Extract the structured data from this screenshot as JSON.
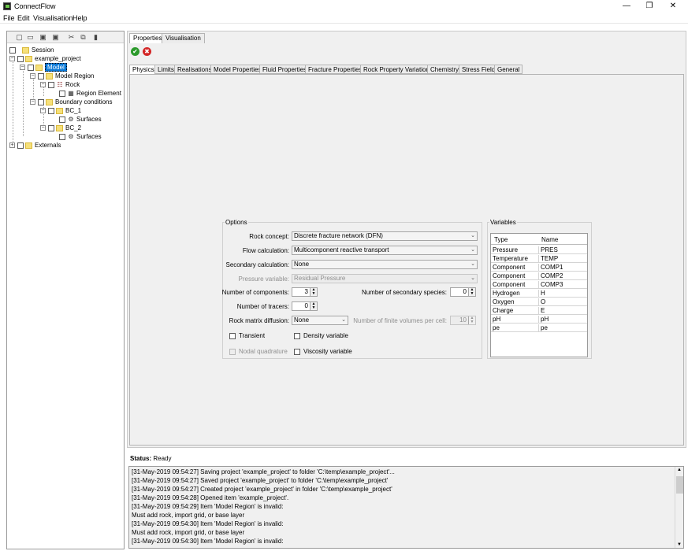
{
  "window": {
    "title": "ConnectFlow",
    "minimize_glyph": "—",
    "restore_glyph": "❐",
    "close_glyph": "✕"
  },
  "menu": [
    "File",
    "Edit",
    "Visualisation",
    "Help"
  ],
  "tree": {
    "toolbar_icons": [
      "new-icon",
      "open-icon",
      "save-icon",
      "save-as-icon",
      "cut-icon",
      "copy-icon",
      "paste-icon"
    ],
    "session": "Session",
    "project": "example_project",
    "model": "Model",
    "model_region": "Model Region",
    "rock": "Rock",
    "region_element": "Region Element",
    "boundary_conditions": "Boundary conditions",
    "bc1": "BC_1",
    "bc1_surfaces": "Surfaces",
    "bc2": "BC_2",
    "bc2_surfaces": "Surfaces",
    "externals": "Externals"
  },
  "panel_tabs": [
    "Properties",
    "Visualisation"
  ],
  "sub_tabs": [
    "Physics",
    "Limits",
    "Realisations",
    "Model Properties",
    "Fluid Properties",
    "Fracture Properties",
    "Rock Property Variation",
    "Chemistry",
    "Stress Field",
    "General"
  ],
  "options": {
    "legend": "Options",
    "rock_concept_label": "Rock concept:",
    "rock_concept_value": "Discrete fracture network (DFN)",
    "flow_calc_label": "Flow calculation:",
    "flow_calc_value": "Multicomponent reactive transport",
    "secondary_calc_label": "Secondary calculation:",
    "secondary_calc_value": "None",
    "pressure_var_label": "Pressure variable:",
    "pressure_var_value": "Residual Pressure",
    "num_components_label": "Number of components:",
    "num_components_value": "3",
    "num_secondary_label": "Number of secondary species:",
    "num_secondary_value": "0",
    "num_tracers_label": "Number of tracers:",
    "num_tracers_value": "0",
    "rock_matrix_label": "Rock matrix diffusion:",
    "rock_matrix_value": "None",
    "finite_volumes_label": "Number of finite volumes per cell:",
    "finite_volumes_value": "10",
    "transient": "Transient",
    "density_variable": "Density variable",
    "nodal_quadrature": "Nodal quadrature",
    "viscosity_variable": "Viscosity variable"
  },
  "variables": {
    "legend": "Variables",
    "col_type": "Type",
    "col_name": "Name",
    "rows": [
      {
        "type": "Pressure",
        "name": "PRES"
      },
      {
        "type": "Temperature",
        "name": "TEMP"
      },
      {
        "type": "Component",
        "name": "COMP1"
      },
      {
        "type": "Component",
        "name": "COMP2"
      },
      {
        "type": "Component",
        "name": "COMP3"
      },
      {
        "type": "Hydrogen",
        "name": "H"
      },
      {
        "type": "Oxygen",
        "name": "O"
      },
      {
        "type": "Charge",
        "name": "E"
      },
      {
        "type": "pH",
        "name": "pH"
      },
      {
        "type": "pe",
        "name": "pe"
      }
    ]
  },
  "status": {
    "label": "Status:",
    "value": "Ready"
  },
  "log": [
    "[31-May-2019 09:54:27] Saving project 'example_project' to folder 'C:\\temp\\example_project'...",
    "[31-May-2019 09:54:27] Saved project 'example_project' to folder 'C:\\temp\\example_project'",
    "[31-May-2019 09:54:27] Created project 'example_project' in folder 'C:\\temp\\example_project'",
    "[31-May-2019 09:54:28] Opened item 'example_project'.",
    "[31-May-2019 09:54:29] Item 'Model Region' is invalid:",
    "Must add rock, import grid, or base layer",
    "[31-May-2019 09:54:30] Item 'Model Region' is invalid:",
    "Must add rock, import grid, or base layer",
    "[31-May-2019 09:54:30] Item 'Model Region' is invalid:"
  ],
  "colors": {
    "selection": "#0a79d8",
    "folder": "#f6e07a",
    "ok": "#2c9a2c",
    "cancel": "#d32626"
  }
}
